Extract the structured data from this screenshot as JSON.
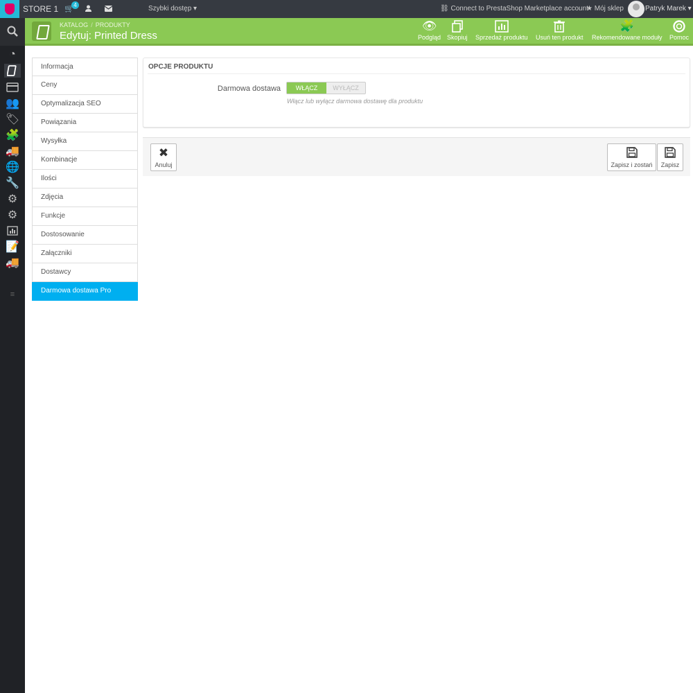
{
  "topbar": {
    "store": "STORE 1",
    "cart_count": "4",
    "quick_access": "Szybki dostęp",
    "connect": "Connect to PrestaShop Marketplace account",
    "my_shop": "Mój sklep",
    "user": "Patryk Marek"
  },
  "header": {
    "breadcrumb_1": "KATALOG",
    "breadcrumb_sep": "/",
    "breadcrumb_2": "PRODUKTY",
    "title": "Edytuj: Printed Dress",
    "actions": [
      "Podgląd",
      "Skopiuj",
      "Sprzedaż produktu",
      "Usuń ten produkt",
      "Rekomendowane moduły",
      "Pomoc"
    ]
  },
  "tabs": [
    "Informacja",
    "Ceny",
    "Optymalizacja SEO",
    "Powiązania",
    "Wysyłka",
    "Kombinacje",
    "Ilości",
    "Zdjęcia",
    "Funkcje",
    "Dostosowanie",
    "Załączniki",
    "Dostawcy",
    "Darmowa dostawa Pro"
  ],
  "active_tab": "Darmowa dostawa Pro",
  "panel": {
    "title": "OPCJE PRODUKTU",
    "field_label": "Darmowa dostawa",
    "switch_on": "WŁĄCZ",
    "switch_off": "WYŁĄCZ",
    "switch_value": "on",
    "help": "Włącz lub wyłącz darmowa dostawę dla produktu"
  },
  "footer": {
    "cancel": "Anuluj",
    "save_stay": "Zapisz i zostań",
    "save": "Zapisz"
  },
  "colors": {
    "accent_green": "#8bc954",
    "active_tab": "#00aff0",
    "topbar": "#363a41",
    "sidebar": "#202226"
  }
}
